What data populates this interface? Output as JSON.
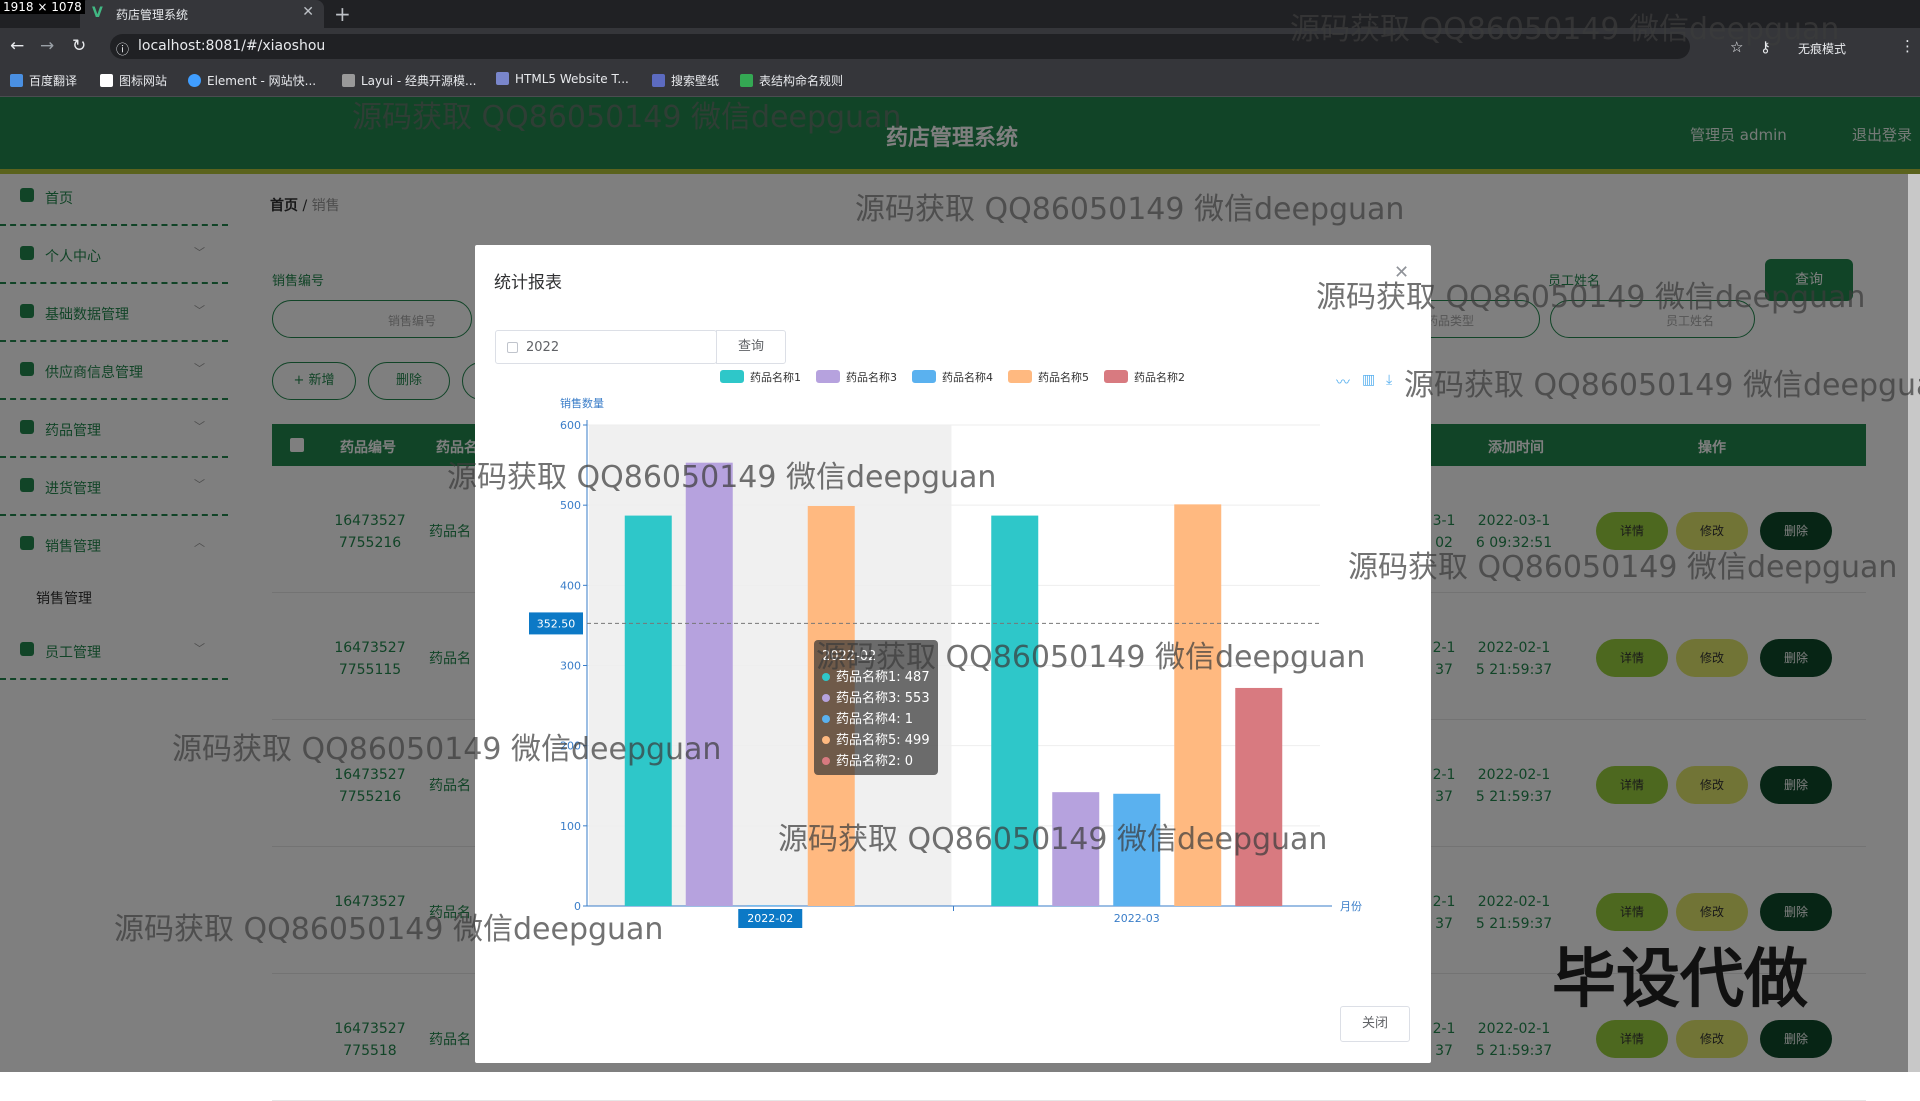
{
  "browser": {
    "dimensions_badge": "1918 × 1078",
    "tab_title": "药店管理系统",
    "url": "localhost:8081/#/xiaoshou",
    "profile": "无痕模式",
    "bookmarks": [
      "百度翻译",
      "图标网站",
      "Element - 网站快...",
      "Layui - 经典开源模...",
      "HTML5 Website T...",
      "搜索壁纸",
      "表结构命名规则"
    ]
  },
  "app": {
    "title": "药店管理系统",
    "user": "管理员 admin",
    "logout": "退出登录",
    "sidebar": [
      "首页",
      "个人中心",
      "基础数据管理",
      "供应商信息管理",
      "药品管理",
      "进货管理",
      "销售管理",
      "员工管理"
    ],
    "sidebar_sub": "销售管理",
    "breadcrumb_home": "首页",
    "breadcrumb_current": "销售",
    "filter": {
      "sale_no_label": "销售编号",
      "sale_no_placeholder": "销售编号",
      "employee_label": "员工姓名",
      "employee_type_placeholder": "药品类型",
      "employee_placeholder": "员工姓名",
      "query": "查询",
      "add": "+ 新增",
      "delete": "删除"
    },
    "table": {
      "headers": [
        "药品编号",
        "药品名",
        "添加时间",
        "操作"
      ],
      "rows": [
        {
          "code": [
            "16473527",
            "7755216"
          ],
          "name": "药品名",
          "t1": [
            "3-1",
            "02"
          ],
          "added": [
            "2022-03-1",
            "6 09:32:51"
          ]
        },
        {
          "code": [
            "16473527",
            "7755115"
          ],
          "name": "药品名",
          "t1": [
            "2-1",
            "37"
          ],
          "added": [
            "2022-02-1",
            "5 21:59:37"
          ]
        },
        {
          "code": [
            "16473527",
            "7755216"
          ],
          "name": "药品名",
          "t1": [
            "2-1",
            "37"
          ],
          "added": [
            "2022-02-1",
            "5 21:59:37"
          ]
        },
        {
          "code": [
            "16473527",
            ""
          ],
          "name": "药品名",
          "t1": [
            "2-1",
            "37"
          ],
          "added": [
            "2022-02-1",
            "5 21:59:37"
          ]
        },
        {
          "code": [
            "16473527",
            "775518"
          ],
          "name": "药品名",
          "t1": [
            "2-1",
            "37"
          ],
          "added": [
            "2022-02-1",
            "5 21:59:37"
          ]
        }
      ],
      "actions": [
        "详情",
        "修改",
        "删除"
      ]
    }
  },
  "modal": {
    "title": "统计报表",
    "year_value": "2022",
    "query": "查询",
    "close": "关闭",
    "tooltip_title": "2022-02"
  },
  "chart_data": {
    "type": "bar",
    "ylabel": "销售数量",
    "xlabel": "月份",
    "ylim": [
      0,
      600
    ],
    "yticks": [
      0,
      100,
      200,
      300,
      400,
      500,
      600
    ],
    "categories": [
      "2022-02",
      "2022-03"
    ],
    "axis_pointer_value": "352.50",
    "series": [
      {
        "name": "药品名称1",
        "color": "#2ec7c9",
        "values": [
          487,
          487
        ]
      },
      {
        "name": "药品名称3",
        "color": "#b6a2de",
        "values": [
          553,
          142
        ]
      },
      {
        "name": "药品名称4",
        "color": "#5ab1ef",
        "values": [
          1,
          140
        ]
      },
      {
        "name": "药品名称5",
        "color": "#ffb980",
        "values": [
          499,
          501
        ]
      },
      {
        "name": "药品名称2",
        "color": "#d87a80",
        "values": [
          0,
          272
        ]
      }
    ]
  },
  "watermark": "源码获取 QQ86050149 微信deepguan",
  "stamp": "毕设代做"
}
